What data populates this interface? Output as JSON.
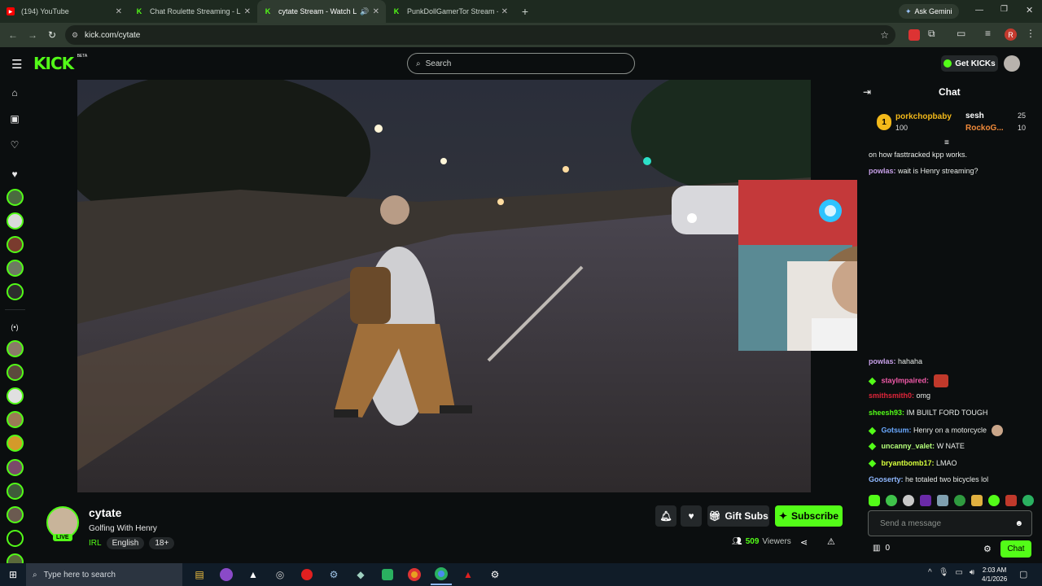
{
  "browser": {
    "tabs": [
      {
        "label": "(194) YouTube",
        "icon": "youtube-icon",
        "active": false
      },
      {
        "label": "Chat Roulette Streaming - Live",
        "icon": "kick-icon",
        "active": false
      },
      {
        "label": "cytate Stream - Watch Live",
        "icon": "kick-icon",
        "active": true
      },
      {
        "label": "PunkDollGamerTor Stream - W",
        "icon": "kick-icon",
        "active": false
      }
    ],
    "new_tab": "+",
    "ask_gemini": "Ask Gemini",
    "url": "kick.com/cytate",
    "profile_initial": "R"
  },
  "kick": {
    "logo": "KICK",
    "logo_beta": "BETA",
    "search_placeholder": "Search",
    "get_kicks": "Get KICKs"
  },
  "stream": {
    "channel": "cytate",
    "title": "Golfing With Henry",
    "live_label": "LIVE",
    "tags": [
      "IRL",
      "English",
      "18+"
    ],
    "viewers_count": "509",
    "viewers_label": "Viewers",
    "gift_subs": "Gift Subs",
    "subscribe": "Subscribe"
  },
  "chat": {
    "title": "Chat",
    "leaderboard": [
      {
        "rank": "1",
        "name": "porkchopbaby",
        "amount": "100"
      },
      {
        "name": "sesh",
        "amount": "25"
      },
      {
        "name": "RockoG...",
        "amount": "10"
      }
    ],
    "messages_top": [
      {
        "user": "",
        "text": "on how fasttracked kpp works.",
        "color": "#e9ece9"
      },
      {
        "user": "powlas:",
        "text": "wait is Henry streaming?",
        "color": "#c7a0e8"
      }
    ],
    "messages_bottom": [
      {
        "user": "powlas:",
        "text": "hahaha",
        "color": "#c7a0e8",
        "badge": false
      },
      {
        "user": "stayImpaired:",
        "text": "",
        "color": "#f05aa8",
        "badge": true
      },
      {
        "user": "smithsmith0:",
        "text": "omg",
        "color": "#e0253a",
        "badge": false
      },
      {
        "user": "sheesh93:",
        "text": "IM BUILT FORD TOUGH",
        "color": "#53fc18",
        "badge": false
      },
      {
        "user": "Gotsum:",
        "text": "Henry on a motorcycle",
        "color": "#6aa9ff",
        "badge": true
      },
      {
        "user": "uncanny_valet:",
        "text": "W NATE",
        "color": "#b5ff7a",
        "badge": true
      },
      {
        "user": "bryantbomb17:",
        "text": "LMAO",
        "color": "#d7ff3c",
        "badge": true
      },
      {
        "user": "Gooserty:",
        "text": "he totaled two bicycles lol",
        "color": "#8fb8ff",
        "badge": false
      }
    ],
    "input_placeholder": "Send a message",
    "points": "0",
    "send_label": "Chat"
  },
  "taskbar": {
    "search_placeholder": "Type here to search",
    "time": "2:03 AM",
    "date": "4/1/2026"
  },
  "colors": {
    "kick_green": "#53fc18",
    "bg": "#0b0e0f",
    "tab_bar": "#1e2a20"
  }
}
